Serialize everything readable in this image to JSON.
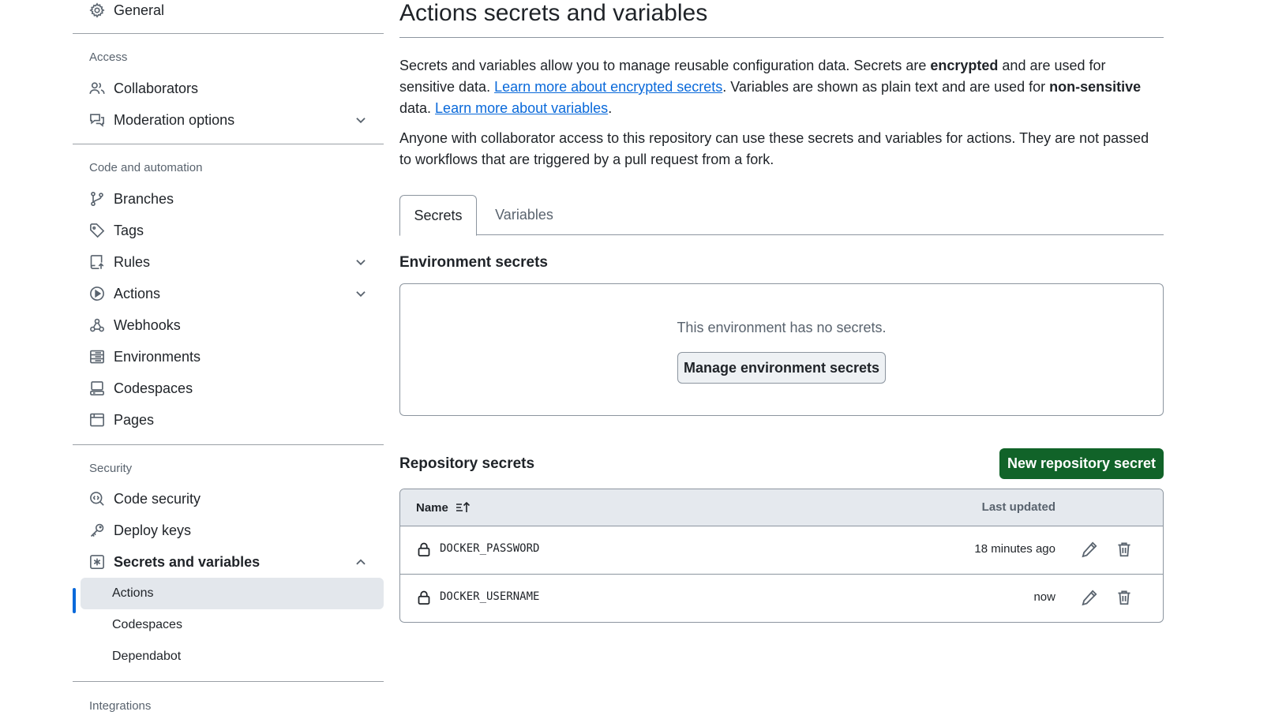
{
  "sidebar": {
    "general": {
      "label": "General",
      "icon": "gear-icon"
    },
    "access": {
      "heading": "Access",
      "items": [
        {
          "label": "Collaborators",
          "icon": "people-icon"
        },
        {
          "label": "Moderation options",
          "icon": "comment-discussion-icon",
          "expandable": true
        }
      ]
    },
    "code_automation": {
      "heading": "Code and automation",
      "items": [
        {
          "label": "Branches",
          "icon": "git-branch-icon"
        },
        {
          "label": "Tags",
          "icon": "tag-icon"
        },
        {
          "label": "Rules",
          "icon": "repo-push-icon",
          "expandable": true
        },
        {
          "label": "Actions",
          "icon": "play-icon",
          "expandable": true
        },
        {
          "label": "Webhooks",
          "icon": "webhook-icon"
        },
        {
          "label": "Environments",
          "icon": "server-icon"
        },
        {
          "label": "Codespaces",
          "icon": "codespaces-icon"
        },
        {
          "label": "Pages",
          "icon": "browser-icon"
        }
      ]
    },
    "security": {
      "heading": "Security",
      "items": [
        {
          "label": "Code security",
          "icon": "codescan-icon"
        },
        {
          "label": "Deploy keys",
          "icon": "key-icon"
        },
        {
          "label": "Secrets and variables",
          "icon": "asterisk-icon",
          "expanded": true
        }
      ],
      "subitems": [
        {
          "label": "Actions",
          "active": true
        },
        {
          "label": "Codespaces"
        },
        {
          "label": "Dependabot"
        }
      ]
    },
    "integrations": {
      "heading": "Integrations"
    }
  },
  "main": {
    "title": "Actions secrets and variables",
    "intro": {
      "p1_a": "Secrets and variables allow you to manage reusable configuration data. Secrets are ",
      "p1_b": "encrypted",
      "p1_c": " and are used for sensitive data. ",
      "p1_link1": "Learn more about encrypted secrets",
      "p1_d": ". Variables are shown as plain text and are used for ",
      "p1_e": "non-sensitive",
      "p1_f": " data. ",
      "p1_link2": "Learn more about variables",
      "p1_g": ".",
      "p2": "Anyone with collaborator access to this repository can use these secrets and variables for actions. They are not passed to workflows that are triggered by a pull request from a fork."
    },
    "tabs": [
      {
        "label": "Secrets",
        "selected": true
      },
      {
        "label": "Variables"
      }
    ],
    "environment": {
      "heading": "Environment secrets",
      "empty_message": "This environment has no secrets.",
      "manage_button": "Manage environment secrets"
    },
    "repository": {
      "heading": "Repository secrets",
      "new_button": "New repository secret",
      "columns": {
        "name": "Name",
        "updated": "Last updated"
      },
      "rows": [
        {
          "name": "DOCKER_PASSWORD",
          "updated": "18 minutes ago"
        },
        {
          "name": "DOCKER_USERNAME",
          "updated": "now"
        }
      ]
    }
  },
  "colors": {
    "accent_link": "#0969da",
    "primary_button": "#116329",
    "active_indicator": "#0969da"
  }
}
